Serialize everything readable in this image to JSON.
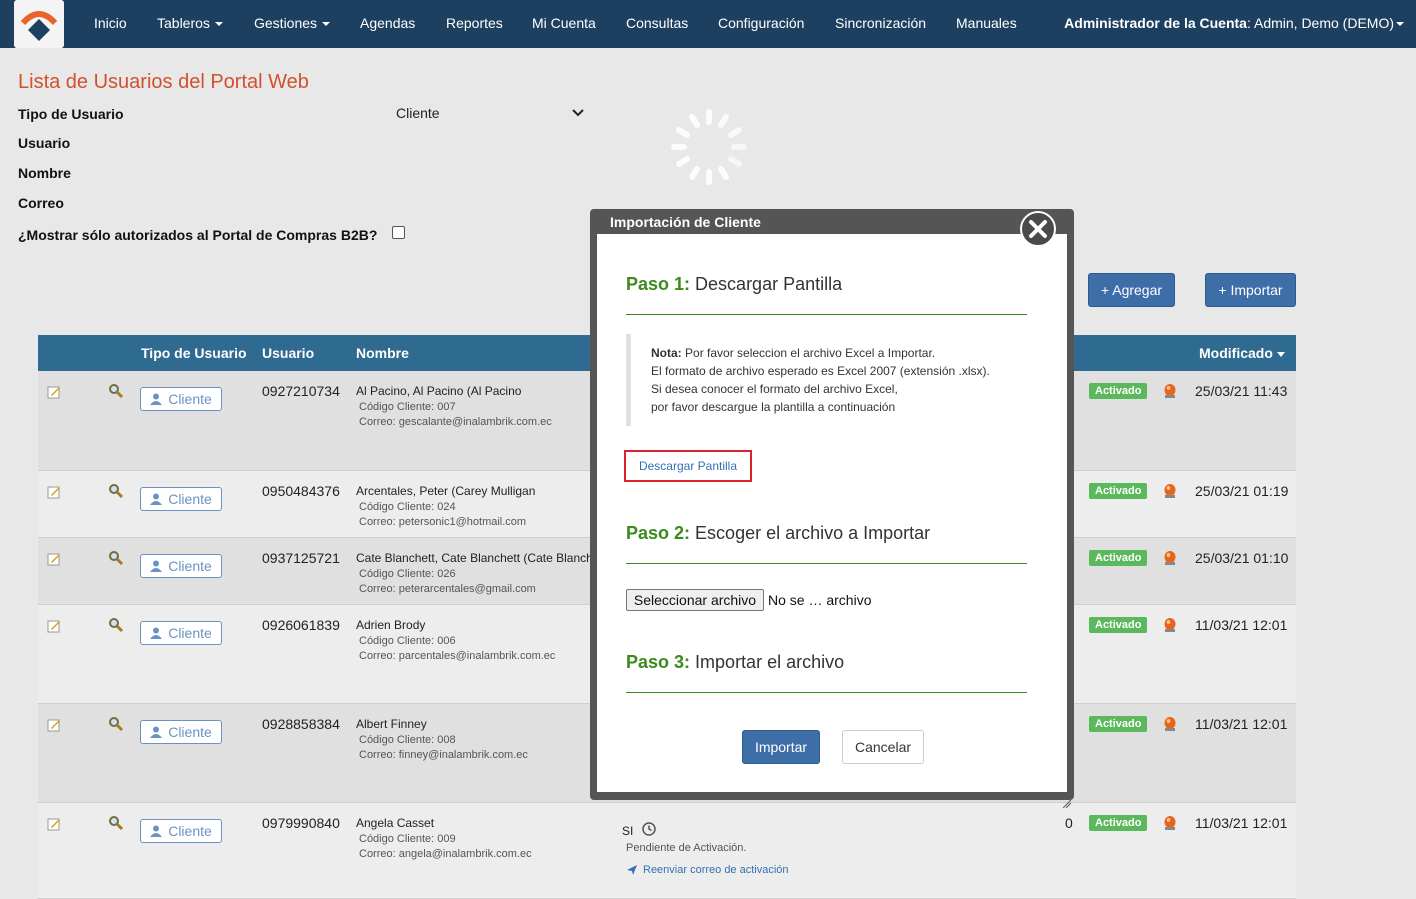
{
  "nav": {
    "items": [
      "Inicio",
      "Tableros",
      "Gestiones",
      "Agendas",
      "Reportes",
      "Mi Cuenta",
      "Consultas",
      "Configuración",
      "Sincronización",
      "Manuales"
    ],
    "account_label": "Administrador de la Cuenta",
    "account_value": ": Admin, Demo (DEMO)"
  },
  "page": {
    "title": "Lista de Usuarios del Portal Web",
    "filters": {
      "tipo_label": "Tipo de Usuario",
      "tipo_value": "Cliente",
      "usuario_label": "Usuario",
      "nombre_label": "Nombre",
      "correo_label": "Correo",
      "autorizados_label": "¿Mostrar sólo autorizados al Portal de Compras B2B?"
    },
    "buttons": {
      "agregar": "+ Agregar",
      "importar": "+ Importar"
    }
  },
  "table": {
    "headers": {
      "tipo": "Tipo de Usuario",
      "usuario": "Usuario",
      "nombre": "Nombre",
      "modificado": "Modificado"
    },
    "rows": [
      {
        "role": "Cliente",
        "usuario": "0927210734",
        "nombre": "Al Pacino, Al Pacino (Al Pacino",
        "codigo": "Código Cliente: 007",
        "correo": "Correo: gescalante@inalambrik.com.ec",
        "status": "Activado",
        "fecha": "25/03/21 11:43"
      },
      {
        "role": "Cliente",
        "usuario": "0950484376",
        "nombre": "Arcentales, Peter (Carey Mulligan",
        "codigo": "Código Cliente: 024",
        "correo": "Correo: petersonic1@hotmail.com",
        "status": "Activado",
        "fecha": "25/03/21 01:19"
      },
      {
        "role": "Cliente",
        "usuario": "0937125721",
        "nombre": "Cate Blanchett, Cate Blanchett (Cate Blanch",
        "codigo": "Código Cliente: 026",
        "correo": "Correo: peterarcentales@gmail.com",
        "status": "Activado",
        "fecha": "25/03/21 01:10"
      },
      {
        "role": "Cliente",
        "usuario": "0926061839",
        "nombre": "Adrien Brody",
        "codigo": "Código Cliente: 006",
        "correo": "Correo: parcentales@inalambrik.com.ec",
        "status": "Activado",
        "fecha": "11/03/21 12:01"
      },
      {
        "role": "Cliente",
        "usuario": "0928858384",
        "nombre": "Albert Finney",
        "codigo": "Código Cliente: 008",
        "correo": "Correo: finney@inalambrik.com.ec",
        "status": "Activado",
        "fecha": "11/03/21 12:01"
      },
      {
        "role": "Cliente",
        "usuario": "0979990840",
        "nombre": "Angela Casset",
        "codigo": "Código Cliente: 009",
        "correo": "Correo: angela@inalambrik.com.ec",
        "status": "Activado",
        "fecha": "11/03/21 12:01"
      }
    ],
    "last_row_extra": {
      "si": "SI",
      "pendiente": "Pendiente de Activación.",
      "reenviar": "Reenviar correo de activación",
      "count": "0"
    }
  },
  "modal": {
    "title": "Importación de Cliente",
    "step1_label": "Paso 1:",
    "step1_text": "Descargar Pantilla",
    "note_bold": "Nota:",
    "note_line1": "Por favor seleccion el archivo Excel a Importar.",
    "note_line2": "El formato de archivo esperado es Excel 2007 (extensión .xlsx).",
    "note_line3": "Si desea conocer el formato del archivo Excel,",
    "note_line4": "por favor descargue la plantilla a continuación",
    "download_link": "Descargar Pantilla",
    "step2_label": "Paso 2:",
    "step2_text": "Escoger el archivo a Importar",
    "file_button": "Seleccionar archivo",
    "file_status": "No se … archivo",
    "step3_label": "Paso 3:",
    "step3_text": "Importar el archivo",
    "import_button": "Importar",
    "cancel_button": "Cancelar"
  },
  "colors": {
    "nav_bg": "#1d4060",
    "title": "#d2512d",
    "header_bg": "#2f6a90",
    "step_green": "#3c8a1a",
    "badge_green": "#5cb85c",
    "primary": "#3e6ea8",
    "highlight": "#d9232d"
  }
}
